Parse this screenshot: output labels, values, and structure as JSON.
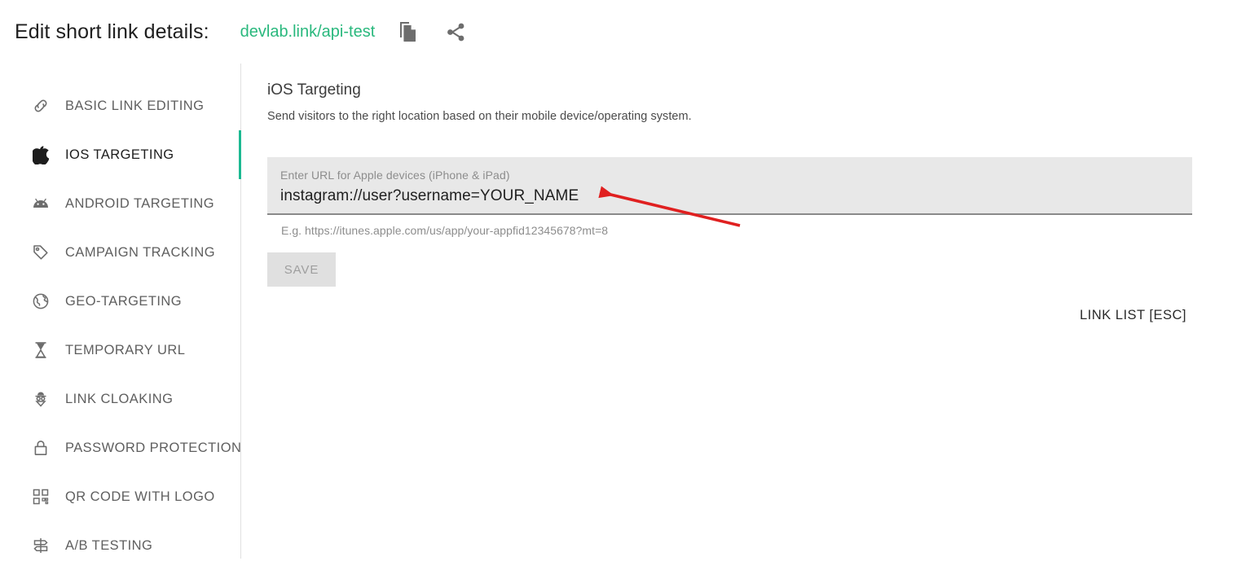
{
  "header": {
    "title": "Edit short link details:",
    "short_link": "devlab.link/api-test",
    "copy_icon": "copy-icon",
    "share_icon": "share-icon",
    "link_color": "#29b87d"
  },
  "sidebar": {
    "active_index": 1,
    "accent_color": "#1cb992",
    "items": [
      {
        "label": "BASIC LINK EDITING",
        "icon": "link-chain-icon"
      },
      {
        "label": "IOS TARGETING",
        "icon": "apple-icon"
      },
      {
        "label": "ANDROID TARGETING",
        "icon": "android-icon"
      },
      {
        "label": "CAMPAIGN TRACKING",
        "icon": "tag-icon"
      },
      {
        "label": "GEO-TARGETING",
        "icon": "globe-icon"
      },
      {
        "label": "TEMPORARY URL",
        "icon": "hourglass-icon"
      },
      {
        "label": "LINK CLOAKING",
        "icon": "spy-icon"
      },
      {
        "label": "PASSWORD PROTECTION",
        "icon": "lock-icon"
      },
      {
        "label": "QR CODE WITH LOGO",
        "icon": "qr-code-icon"
      },
      {
        "label": "A/B TESTING",
        "icon": "signpost-icon"
      }
    ]
  },
  "main": {
    "section_title": "iOS Targeting",
    "section_description": "Send visitors to the right location based on their mobile device/operating system.",
    "field": {
      "label": "Enter URL for Apple devices (iPhone & iPad)",
      "value": "instagram://user?username=YOUR_NAME",
      "placeholder": "Enter URL for Apple devices (iPhone & iPad)",
      "hint": "E.g. https://itunes.apple.com/us/app/your-appfid12345678?mt=8"
    },
    "save_label": "SAVE",
    "link_list_label": "LINK LIST [ESC]"
  },
  "annotation": {
    "arrow_color": "#e02020"
  }
}
